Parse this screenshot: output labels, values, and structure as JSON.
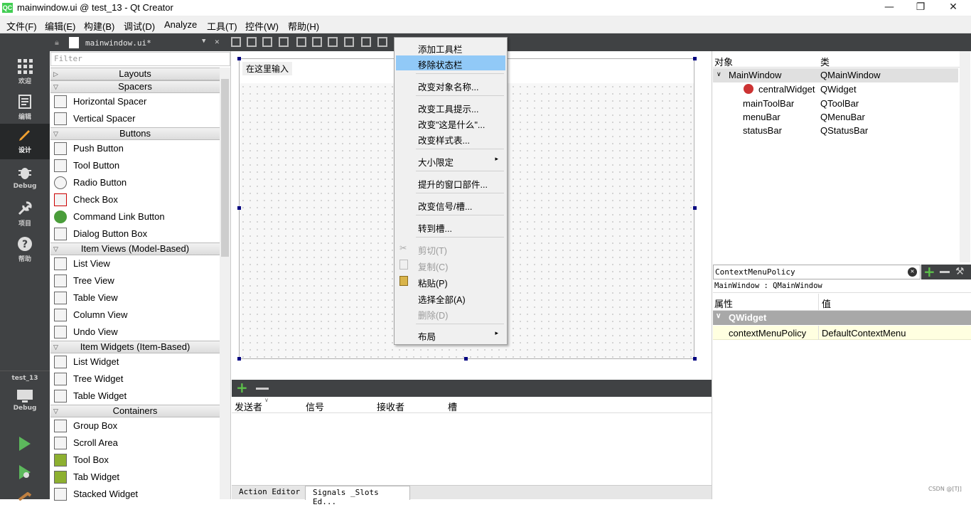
{
  "window": {
    "title": "mainwindow.ui @ test_13 - Qt Creator",
    "app_icon": "QC",
    "controls": {
      "minimize": "—",
      "restore": "❐",
      "close": "✕"
    }
  },
  "menubar": [
    "文件(F)",
    "编辑(E)",
    "构建(B)",
    "调试(D)",
    "Analyze",
    "工具(T)",
    "控件(W)",
    "帮助(H)"
  ],
  "modes": [
    {
      "label": "欢迎",
      "icon": "grid-icon"
    },
    {
      "label": "编辑",
      "icon": "edit-doc-icon"
    },
    {
      "label": "设计",
      "icon": "pen-icon"
    },
    {
      "label": "Debug",
      "icon": "bug-icon"
    },
    {
      "label": "项目",
      "icon": "wrench-icon"
    },
    {
      "label": "帮助",
      "icon": "help-icon"
    }
  ],
  "kit": {
    "project": "test_13",
    "label": "Debug"
  },
  "editor": {
    "doc_tab": "mainwindow.ui*"
  },
  "widgetbox": {
    "filter_placeholder": "Filter",
    "sections": [
      {
        "title": "Layouts",
        "collapsed": true,
        "items": []
      },
      {
        "title": "Spacers",
        "items": [
          "Horizontal Spacer",
          "Vertical Spacer"
        ]
      },
      {
        "title": "Buttons",
        "items": [
          "Push Button",
          "Tool Button",
          "Radio Button",
          "Check Box",
          "Command Link Button",
          "Dialog Button Box"
        ]
      },
      {
        "title": "Item Views (Model-Based)",
        "items": [
          "List View",
          "Tree View",
          "Table View",
          "Column View",
          "Undo View"
        ]
      },
      {
        "title": "Item Widgets (Item-Based)",
        "items": [
          "List Widget",
          "Tree Widget",
          "Table Widget"
        ]
      },
      {
        "title": "Containers",
        "items": [
          "Group Box",
          "Scroll Area",
          "Tool Box",
          "Tab Widget",
          "Stacked Widget"
        ]
      }
    ]
  },
  "form": {
    "type_here": "在这里输入"
  },
  "context_menu": {
    "items": [
      {
        "label": "添加工具栏"
      },
      {
        "label": "移除状态栏",
        "selected": true
      },
      {
        "sep": true
      },
      {
        "label": "改变对象名称..."
      },
      {
        "sep": true
      },
      {
        "label": "改变工具提示..."
      },
      {
        "label": "改变\"这是什么\"..."
      },
      {
        "label": "改变样式表..."
      },
      {
        "sep": true
      },
      {
        "label": "大小限定",
        "submenu": "▸"
      },
      {
        "sep": true
      },
      {
        "label": "提升的窗口部件..."
      },
      {
        "sep": true
      },
      {
        "label": "改变信号/槽..."
      },
      {
        "sep": true
      },
      {
        "label": "转到槽..."
      },
      {
        "sep": true
      },
      {
        "label": "剪切(T)",
        "disabled": true,
        "icon": "cut-icon"
      },
      {
        "label": "复制(C)",
        "disabled": true,
        "icon": "copy-icon"
      },
      {
        "label": "粘贴(P)",
        "icon": "paste-icon"
      },
      {
        "label": "选择全部(A)"
      },
      {
        "label": "删除(D)",
        "disabled": true
      },
      {
        "sep": true
      },
      {
        "label": "布局",
        "submenu": "▸"
      }
    ]
  },
  "signals": {
    "columns": [
      "发送者",
      "信号",
      "接收者",
      "槽"
    ]
  },
  "bottom_tabs": [
    "Action Editor",
    "Signals _Slots Ed..."
  ],
  "object_inspector": {
    "headers": {
      "object": "对象",
      "class": "类"
    },
    "rows": [
      {
        "name": "MainWindow",
        "cls": "QMainWindow"
      },
      {
        "name": "centralWidget",
        "cls": "QWidget"
      },
      {
        "name": "mainToolBar",
        "cls": "QToolBar"
      },
      {
        "name": "menuBar",
        "cls": "QMenuBar"
      },
      {
        "name": "statusBar",
        "cls": "QStatusBar"
      }
    ]
  },
  "property_editor": {
    "filter_value": "ContextMenuPolicy",
    "class_line": "MainWindow : QMainWindow",
    "headers": {
      "prop": "属性",
      "value": "值"
    },
    "section": "QWidget",
    "row": {
      "prop": "contextMenuPolicy",
      "value": "DefaultContextMenu"
    }
  },
  "watermark": "CSDN @[TJ]",
  "colors": {
    "sidebar": "#404244",
    "selection": "#91c9f7",
    "property_highlight": "#ffffe0",
    "run_green": "#5cb85c",
    "handle": "#000080"
  }
}
